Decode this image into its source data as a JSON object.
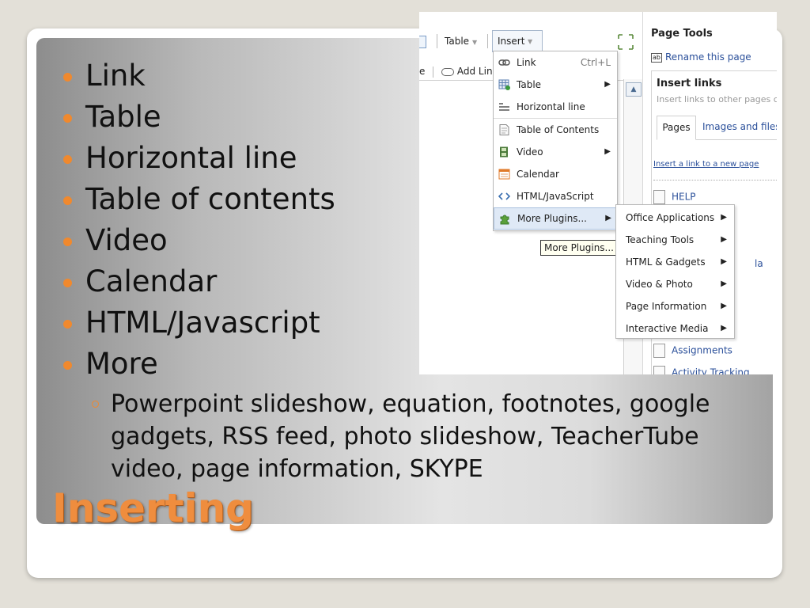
{
  "slide": {
    "title": "Inserting",
    "bullets": [
      "Link",
      "Table",
      "Horizontal line",
      "Table of contents",
      "Video",
      "Calendar",
      "HTML/Javascript",
      "More"
    ],
    "sub_bullet": "Powerpoint slideshow, equation, footnotes, google gadgets, RSS feed, photo slideshow, TeacherTube video, page information, SKYPE",
    "accent_color": "#f0892e",
    "title_color": "#ef8d3e"
  },
  "screenshot": {
    "toolbar": {
      "table_label": "Table",
      "insert_label": "Insert",
      "partial_left": "e",
      "add_link_label": "Add Link"
    },
    "insert_menu": [
      {
        "label": "Link",
        "shortcut": "Ctrl+L",
        "icon": "link-icon",
        "has_submenu": false
      },
      {
        "label": "Table",
        "shortcut": "",
        "icon": "table-icon",
        "has_submenu": true
      },
      {
        "label": "Horizontal line",
        "shortcut": "",
        "icon": "horizontal-line-icon",
        "has_submenu": false
      },
      {
        "label": "Table of Contents",
        "shortcut": "",
        "icon": "document-icon",
        "has_submenu": false
      },
      {
        "label": "Video",
        "shortcut": "",
        "icon": "film-icon",
        "has_submenu": true
      },
      {
        "label": "Calendar",
        "shortcut": "",
        "icon": "calendar-icon",
        "has_submenu": false
      },
      {
        "label": "HTML/JavaScript",
        "shortcut": "",
        "icon": "code-icon",
        "has_submenu": false
      },
      {
        "label": "More Plugins...",
        "shortcut": "",
        "icon": "puzzle-icon",
        "has_submenu": true
      }
    ],
    "arrow_glyph": "▶",
    "tooltip": "More Plugins...",
    "plugins_submenu": [
      "Office Applications",
      "Teaching Tools",
      "HTML & Gadgets",
      "Video & Photo",
      "Page Information",
      "Interactive Media"
    ],
    "page_tools": {
      "title": "Page Tools",
      "rename_icon_text": "ab",
      "rename_label": "Rename this page",
      "insert_links_title": "Insert links",
      "insert_links_sub": "Insert links to other pages c",
      "tab_pages": "Pages",
      "tab_images": "Images and files",
      "new_page_link": "Insert a link to a new page",
      "pages": [
        "HELP",
        "Assignments",
        "Activity Tracking"
      ],
      "partial_text_1": "la"
    }
  }
}
